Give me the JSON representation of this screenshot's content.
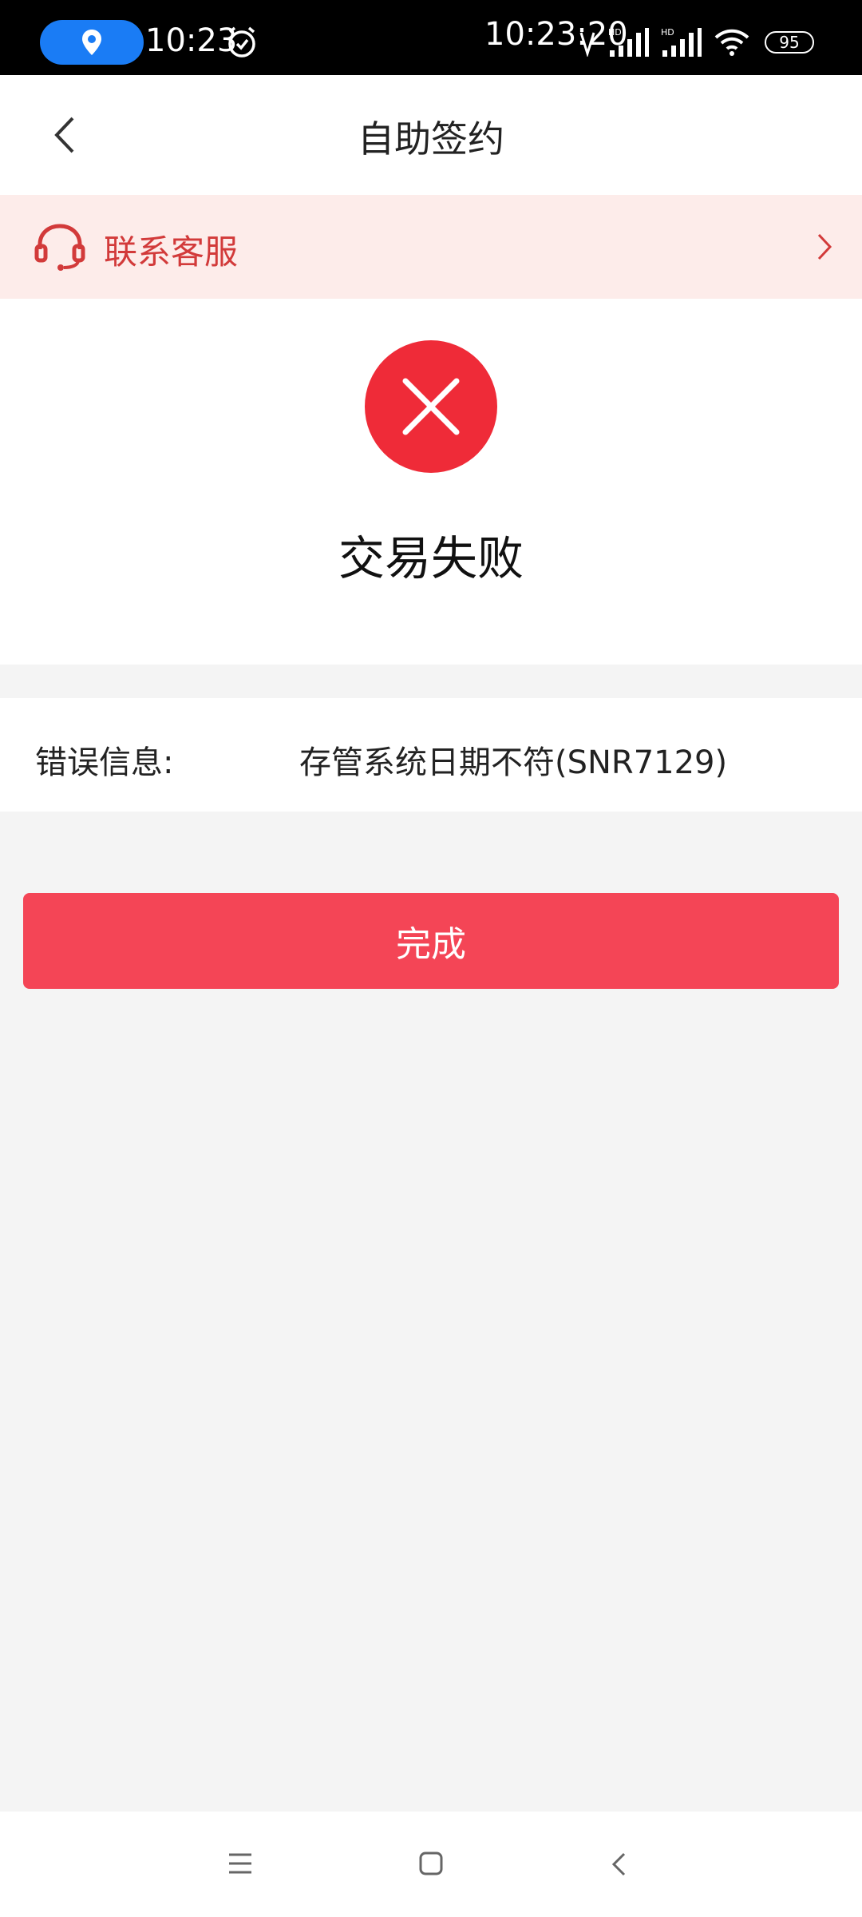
{
  "status_bar": {
    "time_left": "10:23",
    "time_right": "10:23:20",
    "battery": "95",
    "icons": [
      "location-icon",
      "alarm-icon",
      "nfc-icon",
      "signal-hd-icon",
      "signal-hd-icon",
      "wifi-icon",
      "battery-icon"
    ]
  },
  "header": {
    "title": "自助签约",
    "back_icon": "chevron-left-icon"
  },
  "service_banner": {
    "label": "联系客服",
    "icon": "headset-icon",
    "accent_color": "#d23a3a",
    "background": "#fdecea"
  },
  "result": {
    "icon": "close-icon",
    "icon_color": "#ef2b38",
    "title": "交易失败"
  },
  "error": {
    "label": "错误信息:",
    "value": "存管系统日期不符(SNR7129)"
  },
  "actions": {
    "done_label": "完成",
    "done_color": "#f44556"
  },
  "system_nav": {
    "icons": [
      "menu-icon",
      "home-icon",
      "back-icon"
    ]
  }
}
